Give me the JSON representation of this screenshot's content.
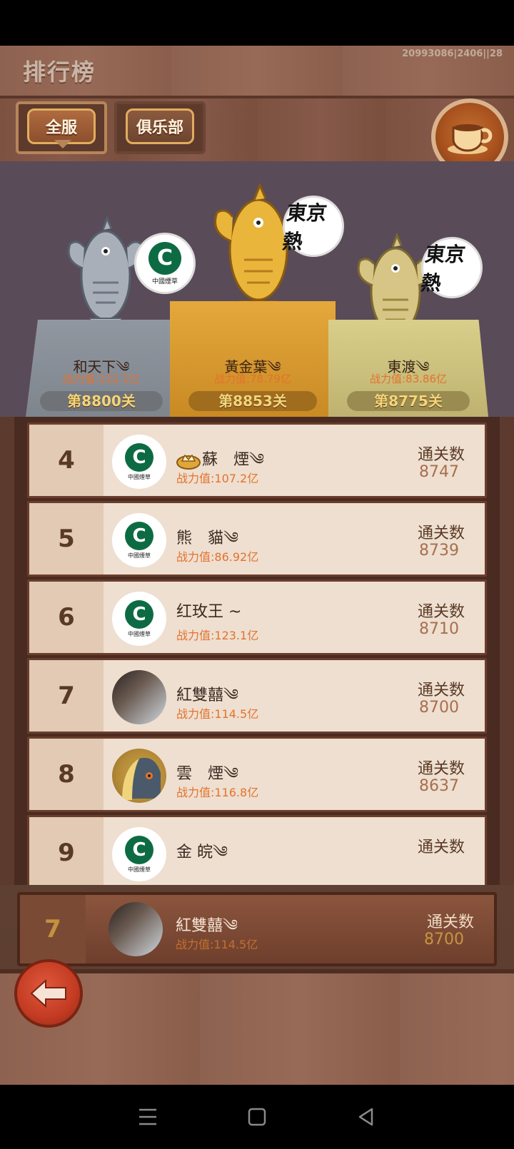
{
  "header": {
    "title": "排行榜",
    "version": "20993086|2406||28"
  },
  "tabs": [
    {
      "label": "全服"
    },
    {
      "label": "俱乐部"
    }
  ],
  "podium": [
    {
      "rank": "2",
      "name": "和天下༄",
      "power": "战力值:122.1亿",
      "level": "第8800关",
      "logo": "中國煙草"
    },
    {
      "rank": "1",
      "name": "黃金葉༄",
      "power": "战力值:78.79亿",
      "level": "第8853关",
      "logo": "東京熱"
    },
    {
      "rank": "3",
      "name": "東渡༄",
      "power": "战力值:83.86亿",
      "level": "第8775关",
      "logo": "東京熱"
    }
  ],
  "list": [
    {
      "rank": "4",
      "name": "蘇　煙༄",
      "power": "战力值:107.2亿",
      "stat_label": "通关数",
      "stat_value": "8747",
      "avatar": "中國煙草"
    },
    {
      "rank": "5",
      "name": "熊　貓༄",
      "power": "战力值:86.92亿",
      "stat_label": "通关数",
      "stat_value": "8739",
      "avatar": "中國煙草"
    },
    {
      "rank": "6",
      "name": "红玫王 ~",
      "power": "战力值:123.1亿",
      "stat_label": "通关数",
      "stat_value": "8710",
      "avatar": "中國煙草"
    },
    {
      "rank": "7",
      "name": "紅雙囍༄",
      "power": "战力值:114.5亿",
      "stat_label": "通关数",
      "stat_value": "8700",
      "avatar": "photo"
    },
    {
      "rank": "8",
      "name": "雲　煙༄",
      "power": "战力值:116.8亿",
      "stat_label": "通关数",
      "stat_value": "8637",
      "avatar": "anime"
    },
    {
      "rank": "9",
      "name": "金 皖༄",
      "power": "",
      "stat_label": "通关数",
      "stat_value": "",
      "avatar": "中國煙草"
    }
  ],
  "my_rank": {
    "rank": "7",
    "name": "紅雙囍༄",
    "power": "战力值:114.5亿",
    "stat_label": "通关数",
    "stat_value": "8700"
  },
  "colors": {
    "power_text": "#e4722e",
    "level_text": "#f3d57a",
    "gold": "#e9b53b",
    "silver": "#a9afb8",
    "bronze": "#d6c584"
  },
  "icons": {
    "coffee": "coffee-cup-icon",
    "back": "back-arrow-icon"
  }
}
